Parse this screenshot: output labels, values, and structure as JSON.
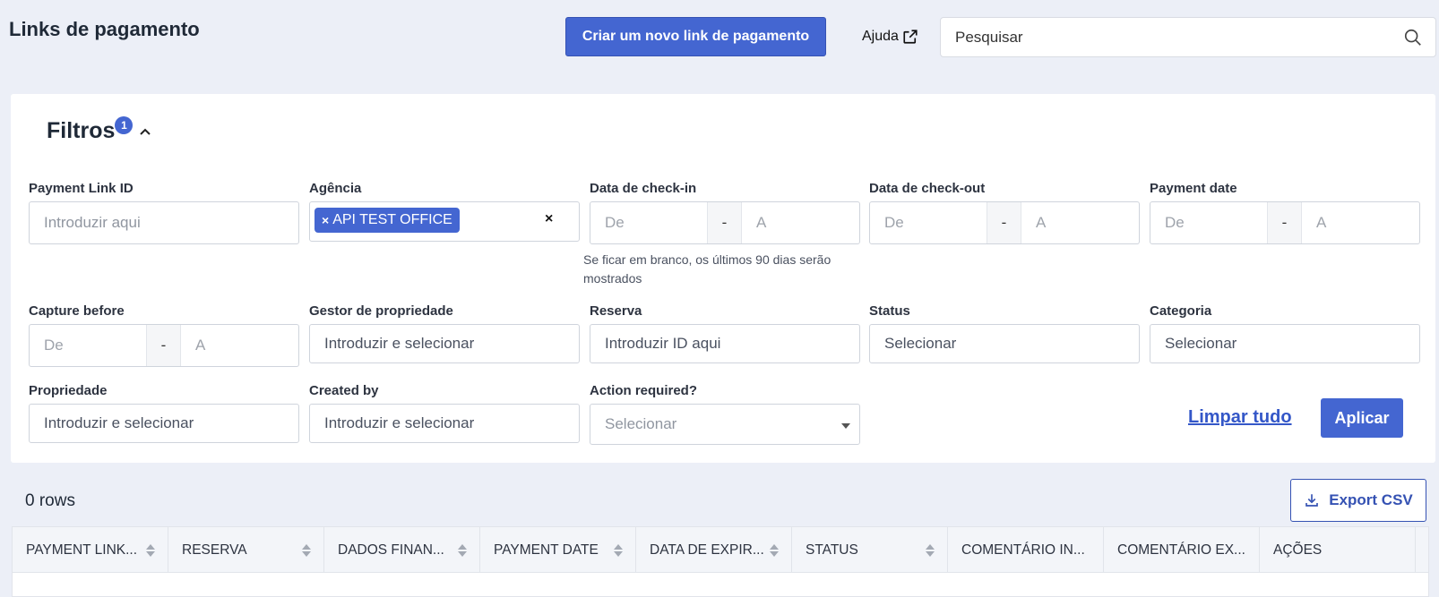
{
  "header": {
    "title": "Links de pagamento",
    "create_button": "Criar um novo link de pagamento",
    "help_link": "Ajuda",
    "search_placeholder": "Pesquisar"
  },
  "filters": {
    "title": "Filtros",
    "badge_count": "1",
    "payment_link_id": {
      "label": "Payment Link ID",
      "placeholder": "Introduzir aqui"
    },
    "agencia": {
      "label": "Agência",
      "chip": "API TEST OFFICE",
      "chip_remove": "×",
      "clear": "×"
    },
    "checkin": {
      "label": "Data de check-in",
      "from": "De",
      "sep": "-",
      "to": "A",
      "hint": "Se ficar em branco, os últimos 90 dias serão mostrados"
    },
    "checkout": {
      "label": "Data de check-out",
      "from": "De",
      "sep": "-",
      "to": "A"
    },
    "payment_date": {
      "label": "Payment date",
      "from": "De",
      "sep": "-",
      "to": "A"
    },
    "capture_before": {
      "label": "Capture before",
      "from": "De",
      "sep": "-",
      "to": "A"
    },
    "gestor": {
      "label": "Gestor de propriedade",
      "placeholder": "Introduzir e selecionar"
    },
    "reserva": {
      "label": "Reserva",
      "placeholder": "Introduzir ID aqui"
    },
    "status": {
      "label": "Status",
      "placeholder": "Selecionar"
    },
    "categoria": {
      "label": "Categoria",
      "placeholder": "Selecionar"
    },
    "propriedade": {
      "label": "Propriedade",
      "placeholder": "Introduzir e selecionar"
    },
    "created_by": {
      "label": "Created by",
      "placeholder": "Introduzir e selecionar"
    },
    "action_required": {
      "label": "Action required?",
      "value": "Selecionar"
    },
    "clear_all": "Limpar tudo",
    "apply": "Aplicar"
  },
  "results": {
    "rows_count": "0 rows",
    "export_button": "Export CSV",
    "columns": [
      {
        "label": "PAYMENT LINK...",
        "sortable": true
      },
      {
        "label": "RESERVA",
        "sortable": true
      },
      {
        "label": "DADOS FINAN...",
        "sortable": true
      },
      {
        "label": "PAYMENT DATE",
        "sortable": true
      },
      {
        "label": "DATA DE EXPIR...",
        "sortable": true
      },
      {
        "label": "STATUS",
        "sortable": true
      },
      {
        "label": "COMENTÁRIO IN...",
        "sortable": false
      },
      {
        "label": "COMENTÁRIO EX...",
        "sortable": false
      },
      {
        "label": "AÇÕES",
        "sortable": false
      }
    ]
  },
  "colors": {
    "primary": "#4466d1",
    "link": "#3457c8",
    "background": "#eceff7"
  }
}
